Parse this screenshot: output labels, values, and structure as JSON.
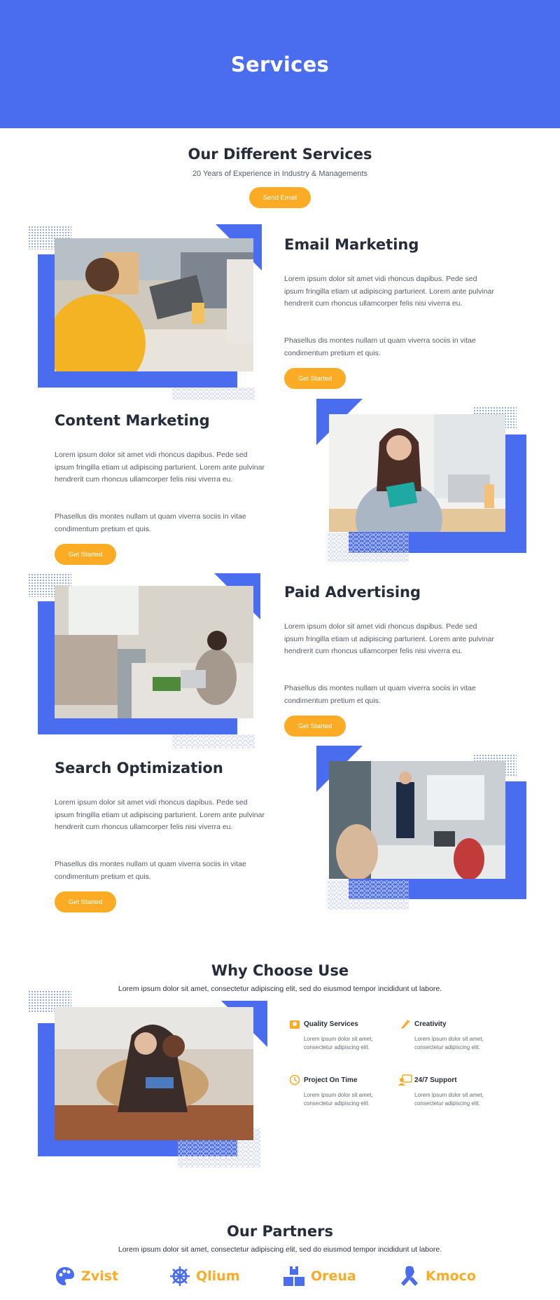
{
  "hero": {
    "title": "Services"
  },
  "intro": {
    "title": "Our Different Services",
    "subtitle": "20 Years of Experience in Industry & Managements",
    "button": "Send Email"
  },
  "services": [
    {
      "title": "Email Marketing",
      "p1": "Lorem ipsum dolor sit amet vidi rhoncus dapibus. Pede sed ipsum fringilla etiam ut adipiscing parturient. Lorem ante pulvinar hendrerit cum rhoncus ullamcorper felis nisi viverra eu.",
      "p2": "Phasellus dis montes nullam ut quam viverra sociis in vitae condimentum pretium et quis.",
      "button": "Get Started"
    },
    {
      "title": "Content Marketing",
      "p1": "Lorem ipsum dolor sit amet vidi rhoncus dapibus. Pede sed ipsum fringilla etiam ut adipiscing parturient. Lorem ante pulvinar hendrerit cum rhoncus ullamcorper felis nisi viverra eu.",
      "p2": "Phasellus dis montes nullam ut quam viverra sociis in vitae condimentum pretium et quis.",
      "button": "Get Started"
    },
    {
      "title": "Paid Advertising",
      "p1": "Lorem ipsum dolor sit amet vidi rhoncus dapibus. Pede sed ipsum fringilla etiam ut adipiscing parturient. Lorem ante pulvinar hendrerit cum rhoncus ullamcorper felis nisi viverra eu.",
      "p2": "Phasellus dis montes nullam ut quam viverra sociis in vitae condimentum pretium et quis.",
      "button": "Get Started"
    },
    {
      "title": "Search Optimization",
      "p1": "Lorem ipsum dolor sit amet vidi rhoncus dapibus. Pede sed ipsum fringilla etiam ut adipiscing parturient. Lorem ante pulvinar hendrerit cum rhoncus ullamcorper felis nisi viverra eu.",
      "p2": "Phasellus dis montes nullam ut quam viverra sociis in vitae condimentum pretium et quis.",
      "button": "Get Started"
    }
  ],
  "why": {
    "title": "Why Choose Use",
    "subtitle": "Lorem ipsum dolor sit amet, consectetur adipiscing elit, sed do eiusmod tempor incididunt ut labore.",
    "features": [
      {
        "icon": "quality-icon",
        "title": "Quality Services",
        "desc": "Lorem ipsum dolor sit amet, consectetur adipiscing elit."
      },
      {
        "icon": "creativity-icon",
        "title": "Creativity",
        "desc": "Lorem ipsum dolor sit amet, consectetur adipiscing elit."
      },
      {
        "icon": "clock-icon",
        "title": "Project On Time",
        "desc": "Lorem ipsum dolor sit amet, consectetur adipiscing elit."
      },
      {
        "icon": "support-icon",
        "title": "24/7 Support",
        "desc": "Lorem ipsum dolor sit amet, consectetur adipiscing elit."
      }
    ]
  },
  "partners": {
    "title": "Our Partners",
    "subtitle": "Lorem ipsum dolor sit amet, consectetur adipiscing elit, sed do eiusmod tempor incididunt ut labore.",
    "items": [
      {
        "name": "Zvist",
        "icon": "palette-icon"
      },
      {
        "name": "Qlium",
        "icon": "helm-icon"
      },
      {
        "name": "Oreua",
        "icon": "boxes-icon"
      },
      {
        "name": "Kmoco",
        "icon": "ribbon-icon"
      }
    ]
  },
  "colors": {
    "primary": "#4a6cee",
    "accent": "#fbac24",
    "heading": "#252c3a"
  }
}
